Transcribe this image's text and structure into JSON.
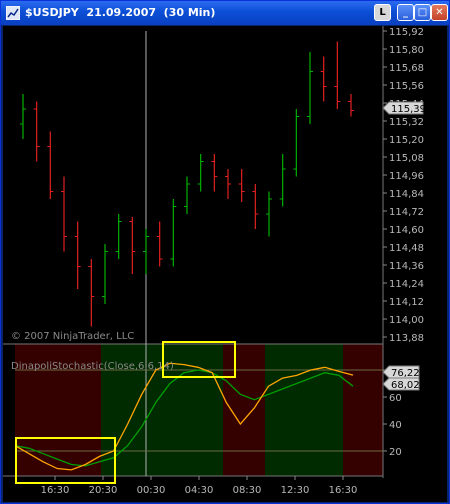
{
  "window": {
    "title": "$USDJPY  21.09.2007  (30 Min)",
    "buttons": [
      {
        "name": "legend-button",
        "label": "L"
      },
      {
        "name": "minimize-button",
        "label": "_"
      },
      {
        "name": "maximize-button",
        "label": "□"
      },
      {
        "name": "close-button",
        "label": "✕"
      }
    ]
  },
  "chart": {
    "copyright": "© 2007 NinjaTrader, LLC",
    "price_ticks": [
      "115,92",
      "115,80",
      "115,68",
      "115,56",
      "115,44",
      "115,32",
      "115,20",
      "115,08",
      "114,96",
      "114,84",
      "114,72",
      "114,60",
      "114,48",
      "114,36",
      "114,24",
      "114,12",
      "114,00",
      "113,88"
    ],
    "last_price": "115,39",
    "indicator": {
      "label": "DinapoliStochastic(Close,6,6,14)",
      "ticks": [
        "80",
        "60",
        "40",
        "20"
      ],
      "value_fast": "76,22",
      "value_slow": "68,02"
    },
    "time_labels": [
      "16:30",
      "20:30",
      "00:30",
      "04:30",
      "08:30",
      "12:30",
      "16:30"
    ],
    "colors": {
      "up": "#00b000",
      "down": "#e02020",
      "fast": "#ffa500",
      "slow": "#00a000",
      "box": "#ffff00",
      "zone_red": "#350000",
      "zone_green": "#002a00"
    }
  },
  "chart_data": {
    "type": "line",
    "title": "",
    "price_range": [
      113.88,
      115.92
    ],
    "candles": [
      [
        115.3,
        115.5,
        115.2,
        115.4
      ],
      [
        115.4,
        115.45,
        115.05,
        115.15
      ],
      [
        115.15,
        115.25,
        114.8,
        114.85
      ],
      [
        114.85,
        114.95,
        114.45,
        114.55
      ],
      [
        114.55,
        114.65,
        114.2,
        114.35
      ],
      [
        114.35,
        114.4,
        113.95,
        114.15
      ],
      [
        114.15,
        114.5,
        114.1,
        114.45
      ],
      [
        114.45,
        114.7,
        114.4,
        114.65
      ],
      [
        114.65,
        114.68,
        114.3,
        114.45
      ],
      [
        114.45,
        114.6,
        114.3,
        114.55
      ],
      [
        114.55,
        114.65,
        114.35,
        114.4
      ],
      [
        114.4,
        114.8,
        114.35,
        114.75
      ],
      [
        114.75,
        114.95,
        114.7,
        114.9
      ],
      [
        114.9,
        115.1,
        114.85,
        115.05
      ],
      [
        115.05,
        115.1,
        114.85,
        114.95
      ],
      [
        114.95,
        115.0,
        114.8,
        114.9
      ],
      [
        114.9,
        115.0,
        114.78,
        114.85
      ],
      [
        114.85,
        114.9,
        114.6,
        114.7
      ],
      [
        114.7,
        114.85,
        114.55,
        114.8
      ],
      [
        114.8,
        115.1,
        114.75,
        115.0
      ],
      [
        115.0,
        115.4,
        114.95,
        115.35
      ],
      [
        115.35,
        115.78,
        115.3,
        115.65
      ],
      [
        115.65,
        115.75,
        115.45,
        115.55
      ],
      [
        115.55,
        115.85,
        115.4,
        115.45
      ],
      [
        115.45,
        115.5,
        115.35,
        115.39
      ]
    ],
    "indicator_range": [
      0,
      100
    ],
    "fast": [
      24,
      18,
      12,
      7,
      6,
      10,
      16,
      20,
      40,
      62,
      80,
      85,
      84,
      82,
      78,
      56,
      40,
      52,
      68,
      74,
      76,
      80,
      82,
      79,
      76.22
    ],
    "slow": [
      24,
      22,
      18,
      14,
      10,
      9,
      12,
      15,
      24,
      38,
      56,
      70,
      78,
      80,
      78,
      72,
      62,
      58,
      62,
      66,
      70,
      74,
      78,
      76,
      68.02
    ]
  }
}
